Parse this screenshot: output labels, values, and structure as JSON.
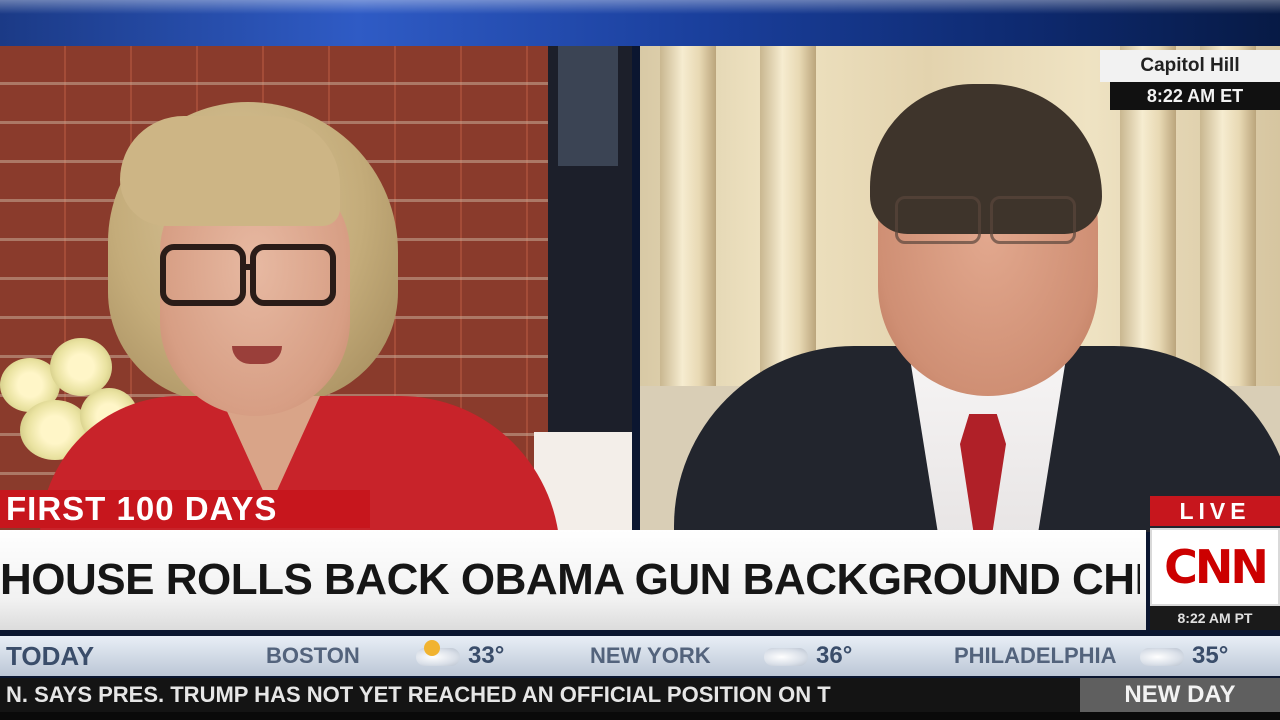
{
  "location": {
    "place": "Capitol Hill",
    "time": "8:22 AM ET"
  },
  "lower_third": {
    "section": "FIRST 100 DAYS",
    "headline": "HOUSE ROLLS BACK OBAMA GUN BACKGROUND CHECK RULE"
  },
  "network": {
    "live": "LIVE",
    "logo": "CNN",
    "time": "8:22 AM PT"
  },
  "weather": {
    "label": "TODAY",
    "cities": [
      {
        "name": "BOSTON",
        "temp": "33°",
        "icon": "partly-sunny-icon"
      },
      {
        "name": "NEW YORK",
        "temp": "36°",
        "icon": "cloud-icon"
      },
      {
        "name": "PHILADELPHIA",
        "temp": "35°",
        "icon": "cloud-icon"
      }
    ]
  },
  "ticker": {
    "text": "N. SAYS PRES. TRUMP HAS NOT YET REACHED AN OFFICIAL POSITION ON T"
  },
  "show": {
    "name": "NEW DAY"
  }
}
